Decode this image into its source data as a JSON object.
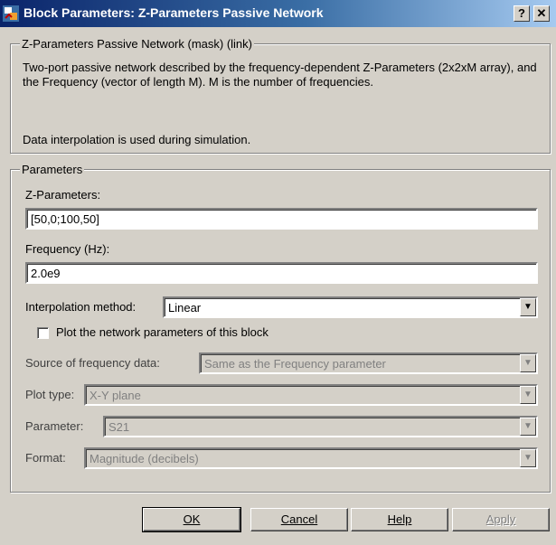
{
  "window": {
    "title": "Block Parameters: Z-Parameters Passive Network",
    "help_glyph": "?",
    "close_glyph": "✕"
  },
  "description": {
    "group_title": "Z-Parameters Passive Network (mask) (link)",
    "text": "Two-port passive network described by the frequency-dependent Z-Parameters (2x2xM array), and the Frequency (vector of length M).  M is the number of frequencies.",
    "note": "Data interpolation is used during simulation."
  },
  "parameters": {
    "group_title": "Parameters",
    "z_params": {
      "label": "Z-Parameters:",
      "value": "[50,0;100,50]"
    },
    "frequency": {
      "label": "Frequency (Hz):",
      "value": "2.0e9"
    },
    "interpolation": {
      "label": "Interpolation method:",
      "value": "Linear"
    },
    "plot_checkbox": {
      "label": "Plot the network parameters of this block",
      "checked": false
    },
    "source_freq": {
      "label": "Source of frequency data:",
      "value": "Same as the Frequency parameter"
    },
    "plot_type": {
      "label": "Plot type:",
      "value": "X-Y plane"
    },
    "parameter": {
      "label": "Parameter:",
      "value": "S21"
    },
    "format": {
      "label": "Format:",
      "value": "Magnitude (decibels)"
    }
  },
  "buttons": {
    "ok": "OK",
    "cancel": "Cancel",
    "help": "Help",
    "apply": "Apply"
  },
  "icons": {
    "title_icon": "simulink-block-icon",
    "dropdown": "chevron-down-icon"
  },
  "colors": {
    "title_bar": "#0a246a",
    "face": "#d4d0c8"
  }
}
